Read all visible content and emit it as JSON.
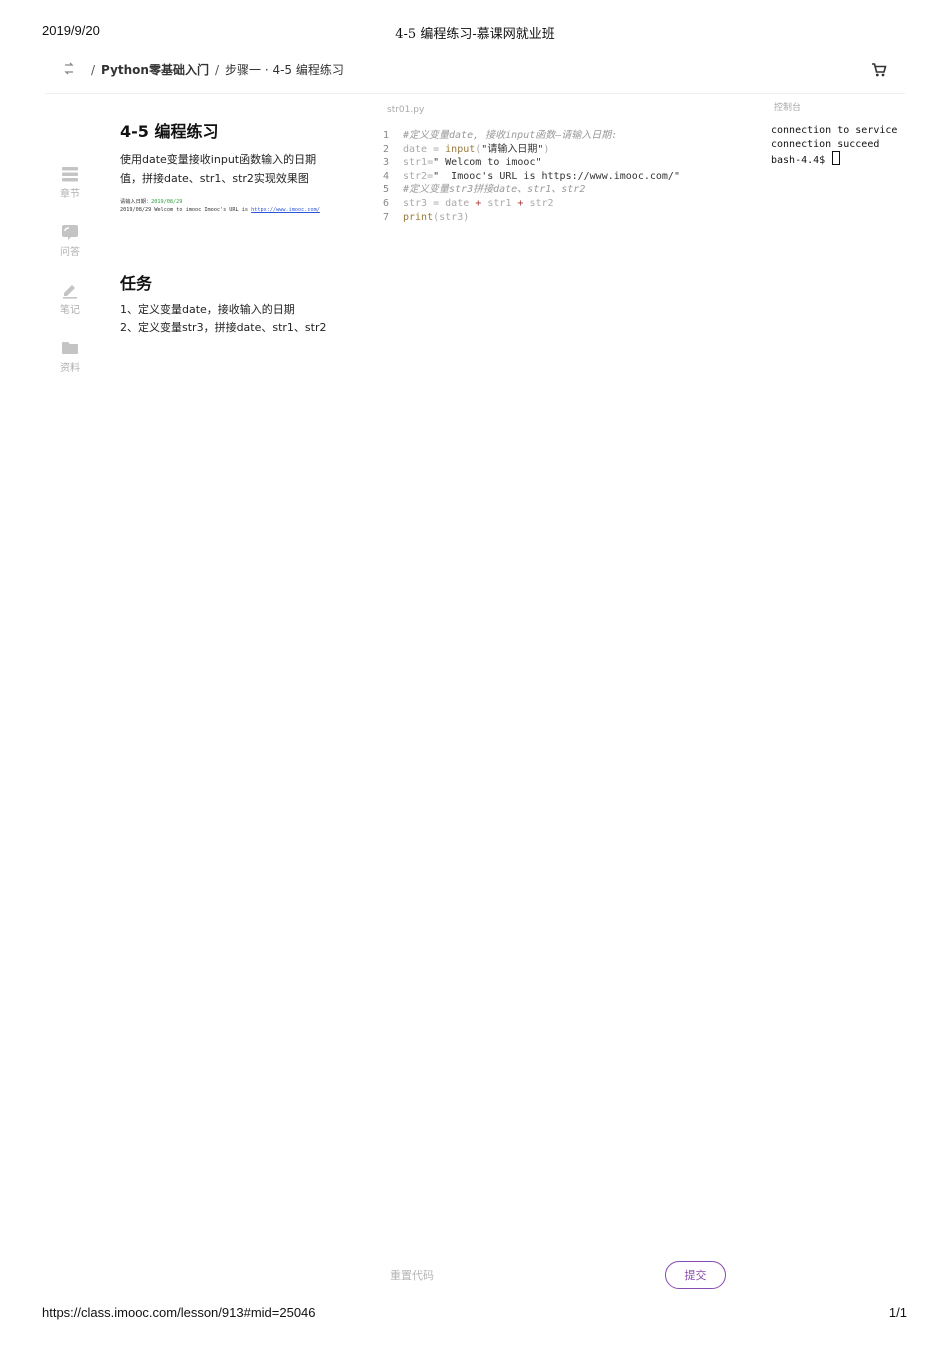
{
  "print_header": {
    "date": "2019/9/20",
    "title": "4-5 编程练习-慕课网就业班"
  },
  "print_footer": {
    "url": "https://class.imooc.com/lesson/913#mid=25046",
    "page": "1/1"
  },
  "breadcrumb": {
    "course": "Python零基础入门",
    "step": "步骤一 · 4-5 编程练习"
  },
  "sidebar": {
    "items": [
      {
        "label": "章节",
        "icon": "chapter-icon"
      },
      {
        "label": "问答",
        "icon": "qa-icon"
      },
      {
        "label": "笔记",
        "icon": "note-icon"
      },
      {
        "label": "资料",
        "icon": "folder-icon"
      }
    ]
  },
  "lesson": {
    "title": "4-5 编程练习",
    "description": "使用date变量接收input函数输入的日期值，拼接date、str1、str2实现效果图",
    "result_line1_prefix": "请输入日期：",
    "result_line1_value": "2019/08/29",
    "result_line2_text": "2019/08/29 Welcom to imooc  Imooc's URL is ",
    "result_line2_link": "https://www.imooc.com/",
    "task_title": "任务",
    "tasks": [
      "1、定义变量date，接收输入的日期",
      "2、定义变量str3，拼接date、str1、str2"
    ]
  },
  "editor": {
    "filename": "str01.py",
    "lines": [
      {
        "no": "1",
        "comment": "#定义变量date, 接收input函数–请输入日期:"
      },
      {
        "no": "2",
        "var": "date",
        "op": " = ",
        "fn": "input",
        "p1": "(",
        "str": "\"请输入日期\"",
        "p2": ")"
      },
      {
        "no": "3",
        "var": "str1",
        "op": "=",
        "str": "\" Welcom to imooc\""
      },
      {
        "no": "4",
        "var": "str2",
        "op": "=",
        "str": "\"  Imooc's URL is https://www.imooc.com/\""
      },
      {
        "no": "5",
        "comment": "#定义变量str3拼接date、str1、str2"
      },
      {
        "no": "6",
        "var": "str3",
        "op": " = ",
        "a": "date",
        "plus1": " + ",
        "b": "str1",
        "plus2": " + ",
        "c": "str2"
      },
      {
        "no": "7",
        "fn": "print",
        "p1": "(",
        "a": "str3",
        "p2": ")"
      }
    ]
  },
  "console": {
    "label": "控制台",
    "lines": [
      "connection to service",
      "connection succeed",
      "bash-4.4$ "
    ]
  },
  "actions": {
    "reset": "重置代码",
    "submit": "提交"
  },
  "colors": {
    "accent": "#8a4bb0",
    "muted": "#b0b0b0"
  }
}
